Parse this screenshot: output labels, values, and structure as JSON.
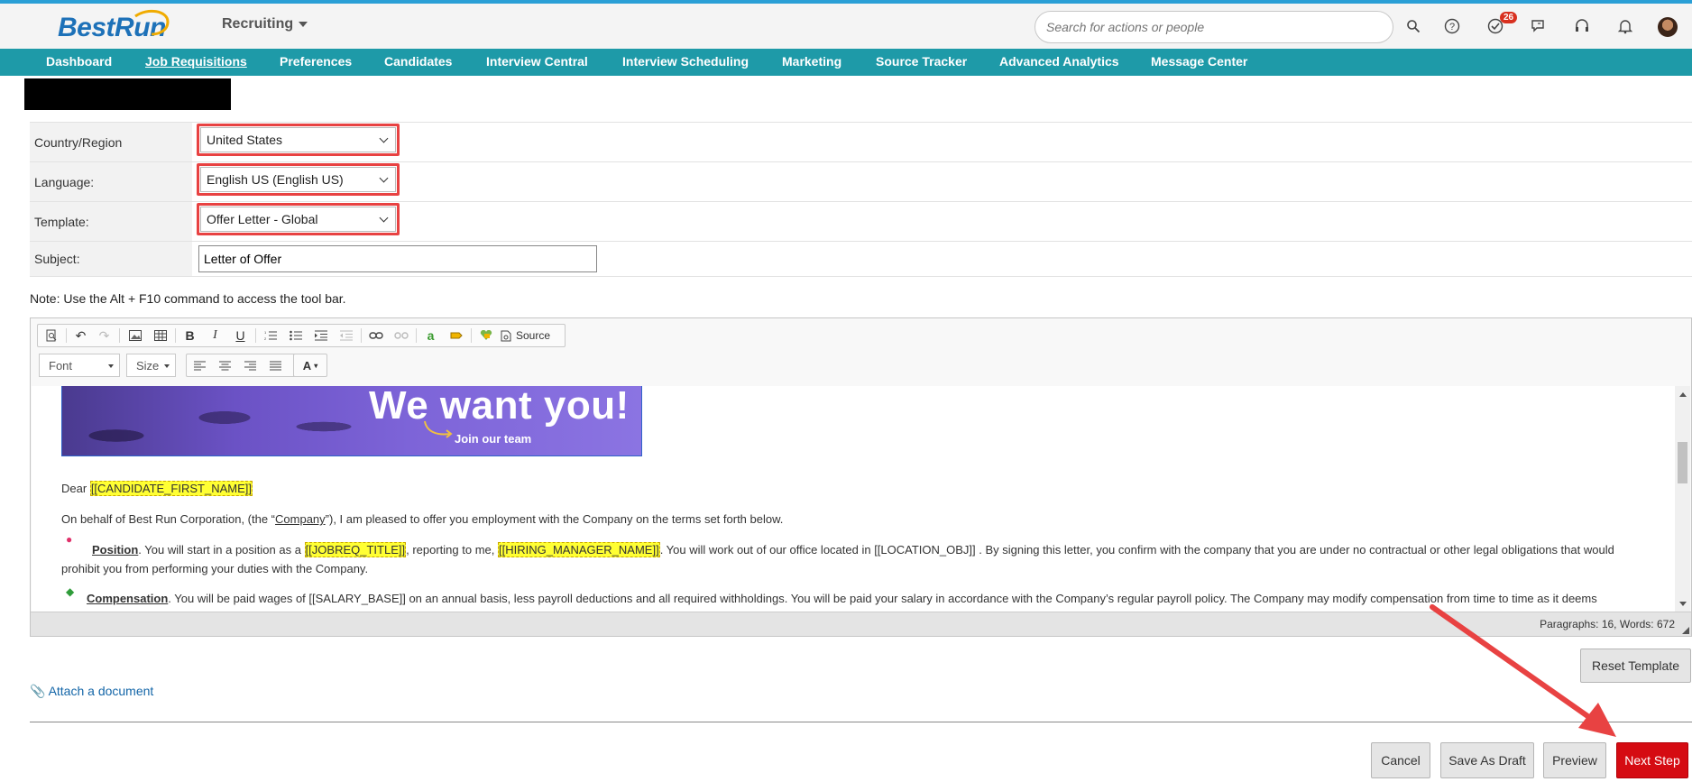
{
  "header": {
    "logo_best": "Best",
    "logo_run": "Run",
    "module": "Recruiting",
    "search_placeholder": "Search for actions or people",
    "notifications_badge": "26"
  },
  "nav": {
    "items": [
      "Dashboard",
      "Job Requisitions",
      "Preferences",
      "Candidates",
      "Interview Central",
      "Interview Scheduling",
      "Marketing",
      "Source Tracker",
      "Advanced Analytics",
      "Message Center"
    ],
    "active": "Job Requisitions"
  },
  "form": {
    "country_label": "Country/Region",
    "country_value": "United States",
    "language_label": "Language:",
    "language_value": "English US (English US)",
    "template_label": "Template:",
    "template_value": "Offer Letter - Global",
    "subject_label": "Subject:",
    "subject_value": "Letter of Offer"
  },
  "note": "Note: Use the Alt + F10 command to access the tool bar.",
  "toolbar": {
    "source_label": "Source",
    "font_label": "Font",
    "size_label": "Size"
  },
  "banner": {
    "headline": "We want you!",
    "cta": "Join our team"
  },
  "letter": {
    "greeting": "Dear",
    "candidate_token": "[[CANDIDATE_FIRST_NAME]]",
    "para1_a": "On behalf of Best Run Corporation, (the “",
    "para1_company": "Company",
    "para1_b": "”), I am pleased to offer you employment with the Company on the terms set forth below.",
    "position_heading": "Position",
    "position_a": ".  You will start in a position as a ",
    "jobreq_token": "[[JOBREQ_TITLE]]",
    "position_b": ", reporting to me, ",
    "manager_token": "[[HIRING_MANAGER_NAME]]",
    "position_c": ".  You will work out of our office located in [[LOCATION_OBJ]] .   By signing this letter, you confirm with the company that you are under no contractual or other legal obligations that would",
    "position_d": "prohibit you from performing your duties with the Company.",
    "comp_heading": "Compensation",
    "comp_a": ". You will be paid wages of [[SALARY_BASE]]  on an annual basis, less payroll deductions and all required withholdings.   You will be paid your salary in accordance with the Company’s regular payroll policy.  The Company may modify compensation from time to time as it deems"
  },
  "editor_status": "Paragraphs: 16, Words: 672",
  "actions": {
    "reset": "Reset Template",
    "attach": "Attach a document",
    "cancel": "Cancel",
    "save_draft": "Save As Draft",
    "preview": "Preview",
    "next": "Next Step"
  },
  "colors": {
    "nav_bg": "#1e9aa8",
    "primary": "#d50b12",
    "highlight_outline": "#e84242",
    "link": "#1466a8"
  }
}
